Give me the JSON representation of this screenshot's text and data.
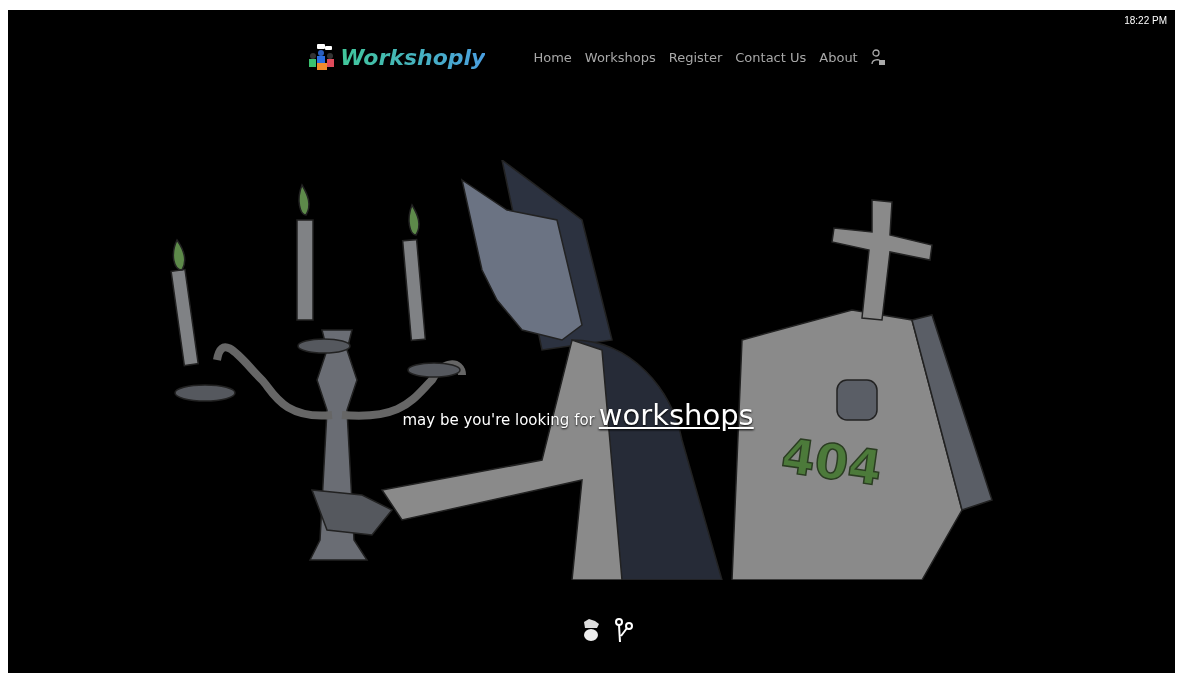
{
  "clock": "18:22 PM",
  "brand": {
    "name": "Workshoply"
  },
  "nav": [
    {
      "label": "Home"
    },
    {
      "label": "Workshops"
    },
    {
      "label": "Register"
    },
    {
      "label": "Contact Us"
    },
    {
      "label": "About"
    }
  ],
  "hero": {
    "tombstone_text": "404",
    "message": "may be you're looking for",
    "link": "workshops"
  }
}
